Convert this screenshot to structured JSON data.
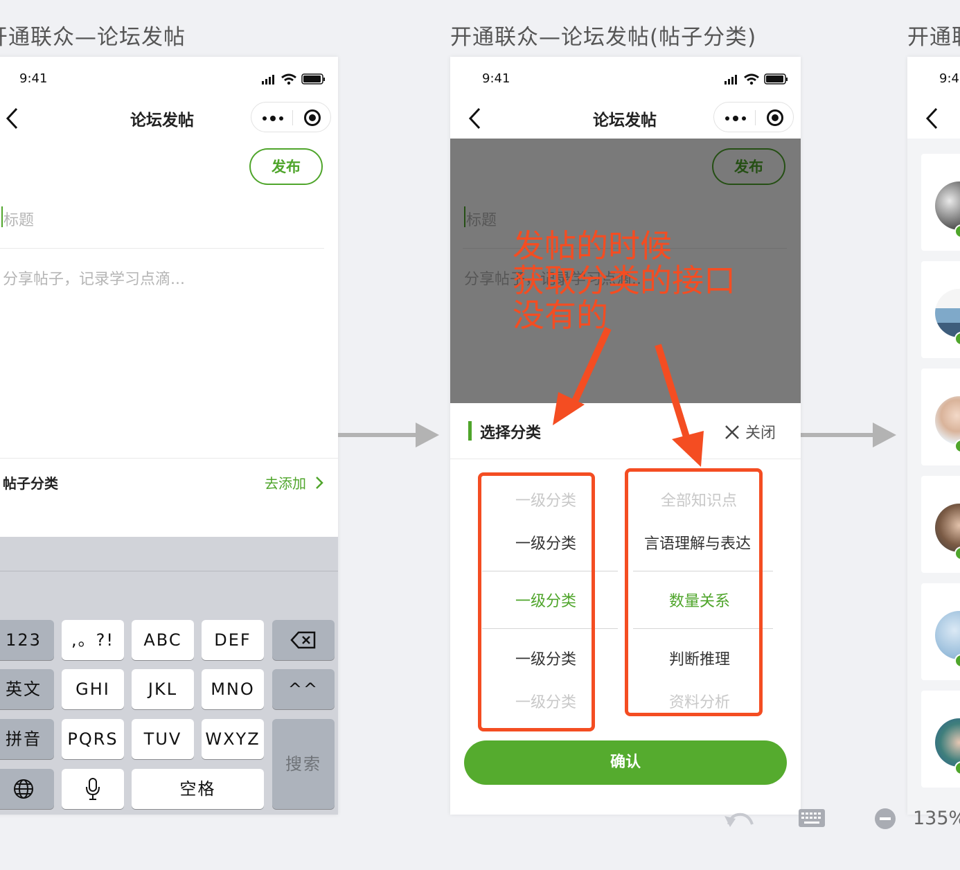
{
  "frames": [
    {
      "label": "开通联众—论坛发帖"
    },
    {
      "label": "开通联众—论坛发帖(帖子分类)"
    },
    {
      "label": "开通联"
    }
  ],
  "status": {
    "time": "9:41"
  },
  "nav": {
    "title": "论坛发帖"
  },
  "post": {
    "publish_label": "发布",
    "title_placeholder": "标题",
    "content_placeholder": "分享帖子，记录学习点滴...",
    "category_label": "帖子分类",
    "add_link": "去添加"
  },
  "keyboard": {
    "keys": [
      "123",
      ",。?!",
      "ABC",
      "DEF",
      "英文",
      "GHI",
      "JKL",
      "MNO",
      "^^",
      "拼音",
      "PQRS",
      "TUV",
      "WXYZ",
      "搜索",
      "空格"
    ]
  },
  "annotation": {
    "lines": [
      "发帖的时候",
      "获取分类的接口",
      "没有的"
    ]
  },
  "sheet": {
    "title": "选择分类",
    "close_label": "关闭",
    "left_items": [
      "一级分类",
      "一级分类",
      "一级分类",
      "一级分类",
      "一级分类"
    ],
    "right_items": [
      "全部知识点",
      "言语理解与表达",
      "数量关系",
      "判断推理",
      "资料分析"
    ],
    "confirm_label": "确认"
  },
  "colors": {
    "accent": "#4fa52b",
    "annotation": "#f44d22",
    "arrow": "#b3b3b3"
  },
  "zoom": "135%"
}
